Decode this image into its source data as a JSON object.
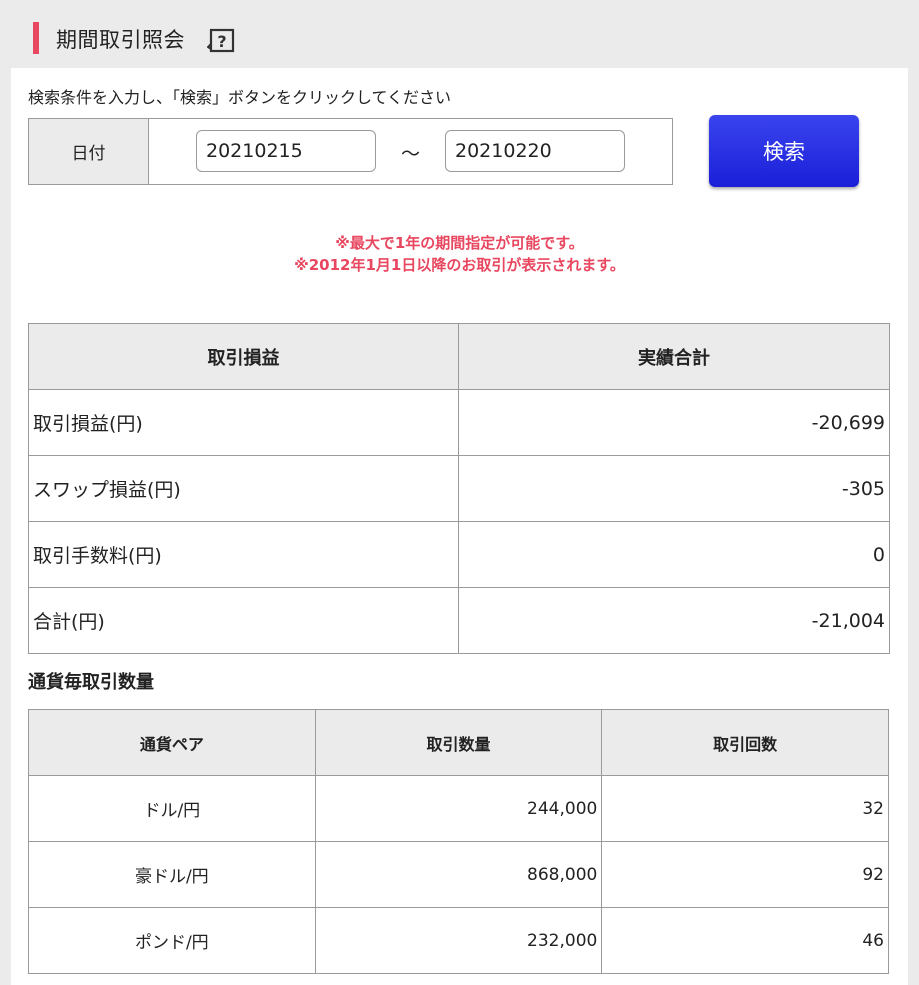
{
  "header": {
    "title": "期間取引照会",
    "help_glyph": "?"
  },
  "search": {
    "instruction": "検索条件を入力し、「検索」ボタンをクリックしてください",
    "date_label": "日付",
    "date_from": "20210215",
    "date_to": "20210220",
    "separator": "～",
    "button_label": "検索"
  },
  "notes": [
    "※最大で1年の期間指定が可能です。",
    "※2012年1月1日以降のお取引が表示されます。"
  ],
  "profit_table": {
    "headers": [
      "取引損益",
      "実績合計"
    ],
    "rows": [
      {
        "label": "取引損益(円)",
        "value": "-20,699"
      },
      {
        "label": "スワップ損益(円)",
        "value": "-305"
      },
      {
        "label": "取引手数料(円)",
        "value": "0"
      },
      {
        "label": "合計(円)",
        "value": "-21,004"
      }
    ]
  },
  "currency_section": {
    "title": "通貨毎取引数量",
    "headers": [
      "通貨ペア",
      "取引数量",
      "取引回数"
    ],
    "rows": [
      {
        "pair": "ドル/円",
        "volume": "244,000",
        "count": "32"
      },
      {
        "pair": "豪ドル/円",
        "volume": "868,000",
        "count": "92"
      },
      {
        "pair": "ポンド/円",
        "volume": "232,000",
        "count": "46"
      }
    ]
  },
  "colors": {
    "accent": "#e8475f",
    "button": "#2a32e6",
    "header_bg": "#ebebeb"
  }
}
